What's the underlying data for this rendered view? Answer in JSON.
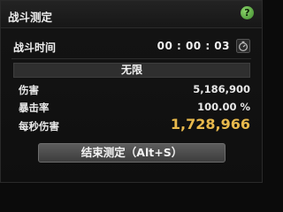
{
  "window": {
    "title": "战斗测定",
    "help_glyph": "?"
  },
  "timer": {
    "label": "战斗时间",
    "value": "00 : 00 : 03",
    "icon": "stopwatch-icon"
  },
  "mode": {
    "label": "无限"
  },
  "stats": [
    {
      "label": "伤害",
      "value": "5,186,900"
    },
    {
      "label": "暴击率",
      "value": "100.00 %"
    },
    {
      "label": "每秒伤害",
      "value": "1,728,966"
    }
  ],
  "button": {
    "label": "结束测定（Alt+S）"
  },
  "colors": {
    "dps_value": "#e8b94c",
    "help_icon": "#5fb243"
  }
}
